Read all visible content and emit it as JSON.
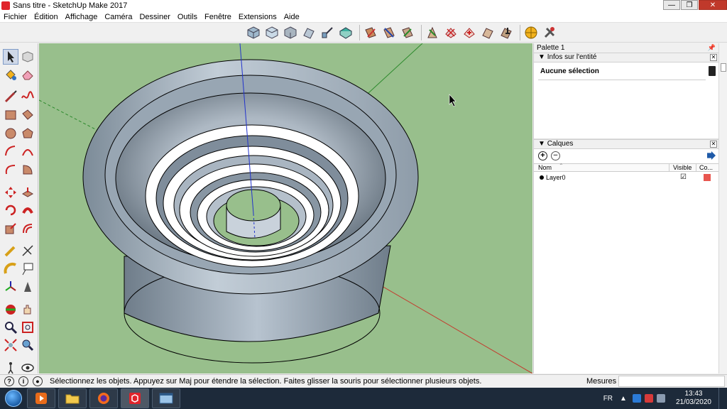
{
  "window": {
    "title": "Sans titre - SketchUp Make 2017",
    "minimize_label": "—",
    "maximize_label": "❐",
    "close_label": "✕"
  },
  "menu": [
    "Fichier",
    "Édition",
    "Affichage",
    "Caméra",
    "Dessiner",
    "Outils",
    "Fenêtre",
    "Extensions",
    "Aide"
  ],
  "panel": {
    "title": "Palette 1",
    "entity_info": {
      "header": "Infos sur l'entité",
      "selection": "Aucune sélection"
    },
    "layers": {
      "header": "Calques",
      "col_name": "Nom",
      "col_visible": "Visible",
      "col_color": "Co...",
      "rows": [
        {
          "name": "Layer0",
          "visible": "☑",
          "color": "#e8564f"
        }
      ]
    }
  },
  "status": {
    "message": "Sélectionnez les objets. Appuyez sur Maj pour étendre la sélection. Faites glisser la souris pour sélectionner plusieurs objets.",
    "measures_label": "Mesures"
  },
  "taskbar": {
    "lang": "FR",
    "time": "13:43",
    "date": "21/03/2020"
  },
  "colors": {
    "viewport_bg": "#98bf8c",
    "model_face": "#b7c3cf",
    "layer_color": "#e8564f"
  }
}
